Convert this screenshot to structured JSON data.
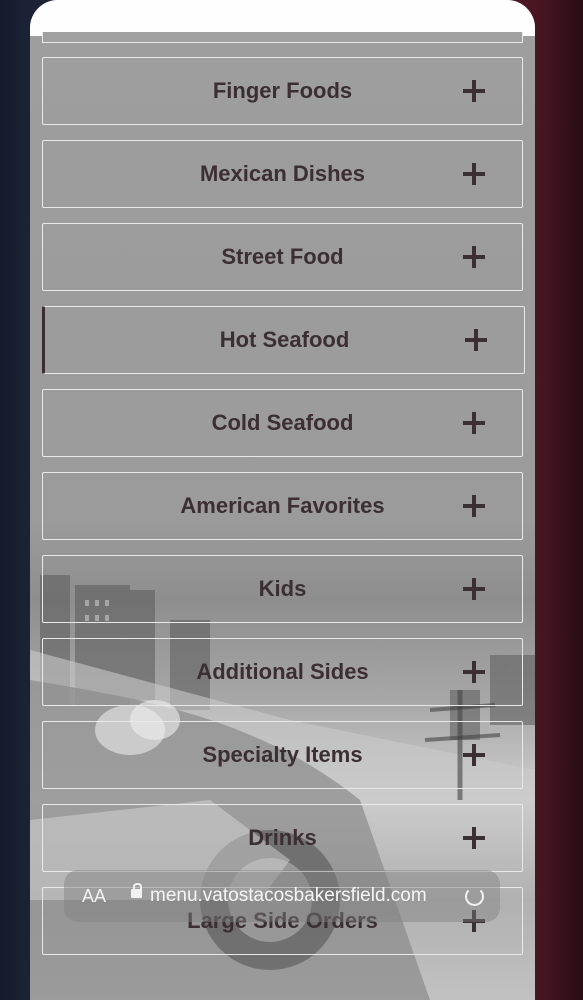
{
  "menu": {
    "categories": [
      {
        "label": "Finger Foods"
      },
      {
        "label": "Mexican Dishes"
      },
      {
        "label": "Street Food"
      },
      {
        "label": "Hot Seafood"
      },
      {
        "label": "Cold Seafood"
      },
      {
        "label": "American Favorites"
      },
      {
        "label": "Kids"
      },
      {
        "label": "Additional Sides"
      },
      {
        "label": "Specialty Items"
      },
      {
        "label": "Drinks"
      },
      {
        "label": "Large Side Orders"
      }
    ]
  },
  "browser": {
    "text_size_label": "AA",
    "url": "menu.vatostacosbakersfield.com"
  },
  "colors": {
    "text": "#3b2f34",
    "border": "#e9e9e9"
  }
}
